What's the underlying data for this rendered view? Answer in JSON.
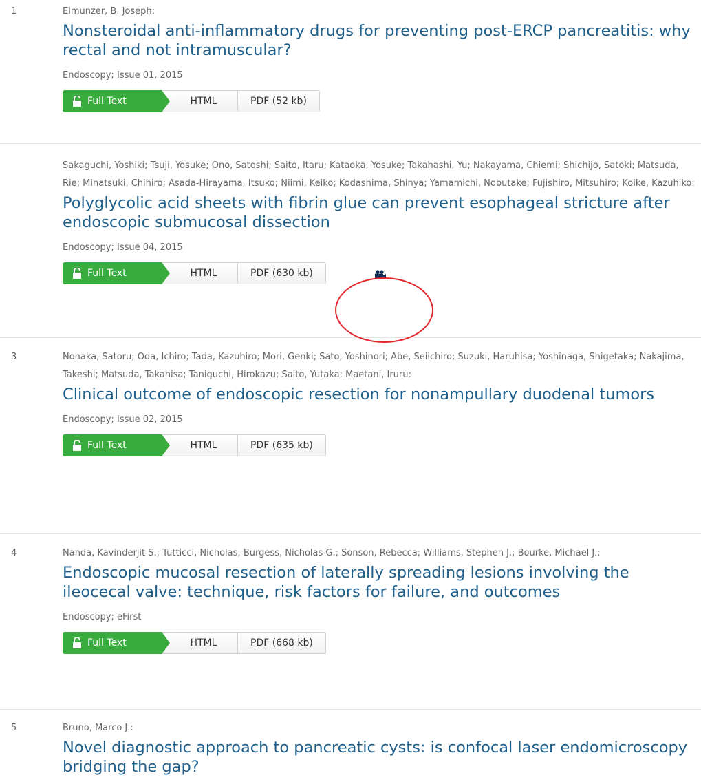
{
  "results": [
    {
      "number": "1",
      "authors": "Elmunzer, B. Joseph:",
      "title": "Nonsteroidal anti-inflammatory drugs for preventing post-ERCP pancreatitis: why rectal and not intramuscular?",
      "journal": "Endoscopy; Issue 01, 2015",
      "fulltext_label": "Full Text",
      "html_label": "HTML",
      "pdf_label": "PDF (52 kb)"
    },
    {
      "number": "",
      "authors": "Sakaguchi, Yoshiki; Tsuji, Yosuke; Ono, Satoshi; Saito, Itaru; Kataoka, Yosuke; Takahashi, Yu; Nakayama, Chiemi; Shichijo, Satoki; Matsuda, Rie; Minatsuki, Chihiro; Asada-Hirayama, Itsuko; Niimi, Keiko; Kodashima, Shinya; Yamamichi, Nobutake; Fujishiro, Mitsuhiro; Koike, Kazuhiko:",
      "title": "Polyglycolic acid sheets with fibrin glue can prevent esophageal stricture after endoscopic submucosal dissection",
      "journal": "Endoscopy; Issue 04, 2015",
      "fulltext_label": "Full Text",
      "html_label": "HTML",
      "pdf_label": "PDF (630 kb)",
      "icon": "video-camera-icon"
    },
    {
      "number": "3",
      "authors": "Nonaka, Satoru; Oda, Ichiro; Tada, Kazuhiro; Mori, Genki; Sato, Yoshinori; Abe, Seiichiro; Suzuki, Haruhisa; Yoshinaga, Shigetaka; Nakajima, Takeshi; Matsuda, Takahisa; Taniguchi, Hirokazu; Saito, Yutaka; Maetani, Iruru:",
      "title": "Clinical outcome of endoscopic resection for nonampullary duodenal tumors",
      "journal": "Endoscopy; Issue 02, 2015",
      "fulltext_label": "Full Text",
      "html_label": "HTML",
      "pdf_label": "PDF (635 kb)"
    },
    {
      "number": "4",
      "authors": "Nanda, Kavinderjit S.; Tutticci, Nicholas; Burgess, Nicholas G.; Sonson, Rebecca; Williams, Stephen J.; Bourke, Michael J.:",
      "title": "Endoscopic mucosal resection of laterally spreading lesions involving the ileocecal valve: technique, risk factors for failure, and outcomes",
      "journal": "Endoscopy; eFirst",
      "fulltext_label": "Full Text",
      "html_label": "HTML",
      "pdf_label": "PDF (668 kb)"
    },
    {
      "number": "5",
      "authors": "Bruno, Marco J.:",
      "title": "Novel diagnostic approach to pancreatic cysts: is confocal laser endomicroscopy bridging the gap?"
    }
  ],
  "colors": {
    "title": "#1f5f8b",
    "fulltext_green": "#3aab3e",
    "annotation_circle": "#e3262b"
  }
}
